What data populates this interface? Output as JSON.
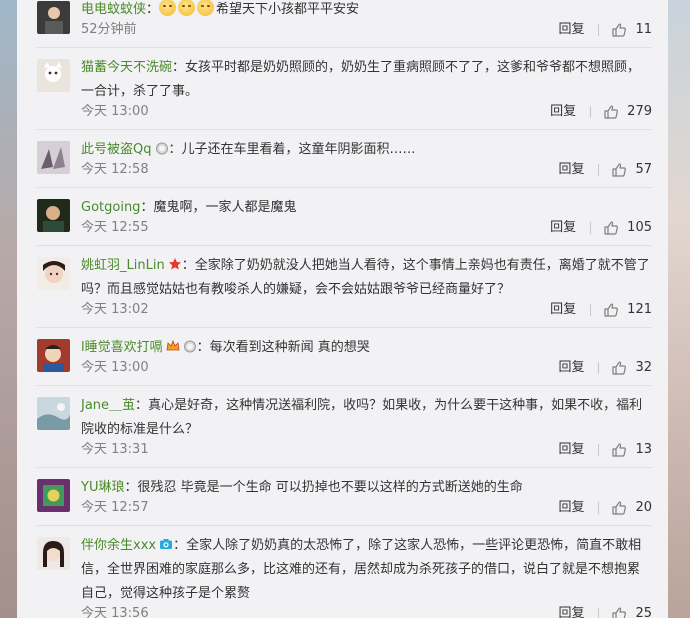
{
  "comments": [
    {
      "user": "电电蚊蚊侠",
      "text": "希望天下小孩都平平安安",
      "time": "52分钟前",
      "reply": "回复",
      "likes": "11",
      "badges": [],
      "emojis": 3,
      "avatar": "avatar-1"
    },
    {
      "user": "猫蓄今天不洗碗",
      "text": "女孩平时都是奶奶照顾的，奶奶生了重病照顾不了了，这爹和爷爷都不想照顾，一合计，杀了了事。",
      "time": "今天 13:00",
      "reply": "回复",
      "likes": "279",
      "badges": [],
      "avatar": "avatar-2"
    },
    {
      "user": "此号被盗Qq",
      "text": "儿子还在车里看着，这童年阴影面积……",
      "time": "今天 12:58",
      "reply": "回复",
      "likes": "57",
      "badges": [
        "medal"
      ],
      "avatar": "avatar-3"
    },
    {
      "user": "Gotgoing",
      "text": "魔鬼啊，一家人都是魔鬼",
      "time": "今天 12:55",
      "reply": "回复",
      "likes": "105",
      "badges": [],
      "avatar": "avatar-4"
    },
    {
      "user": "姚虹羽_LinLin",
      "text": "全家除了奶奶就没人把她当人看待，这个事情上亲妈也有责任，离婚了就不管了吗？而且感觉姑姑也有教唆杀人的嫌疑，会不会姑姑跟爷爷已经商量好了？",
      "time": "今天 13:02",
      "reply": "回复",
      "likes": "121",
      "badges": [
        "star"
      ],
      "avatar": "avatar-5"
    },
    {
      "user": "l睡觉喜欢打嗝",
      "text": "每次看到这种新闻 真的想哭",
      "time": "今天 13:00",
      "reply": "回复",
      "likes": "32",
      "badges": [
        "crown",
        "medal"
      ],
      "avatar": "avatar-6"
    },
    {
      "user": "Jane＿茧",
      "text": "真心是好奇，这种情况送福利院，收吗？如果收，为什么要干这种事，如果不收，福利院收的标准是什么？",
      "time": "今天 13:31",
      "reply": "回复",
      "likes": "13",
      "badges": [],
      "avatar": "avatar-7"
    },
    {
      "user": "YU琳琅",
      "text": "很残忍 毕竟是一个生命 可以扔掉也不要以这样的方式断送她的生命",
      "time": "今天 12:57",
      "reply": "回复",
      "likes": "20",
      "badges": [],
      "avatar": "avatar-8"
    },
    {
      "user": "伴你余生xxx",
      "text": "全家人除了奶奶真的太恐怖了，除了这家人恐怖，一些评论更恐怖，简直不敢相信，全世界困难的家庭那么多，比这难的还有，居然却成为杀死孩子的借口，说白了就是不想抱累自己，觉得这种孩子是个累赘",
      "time": "今天 13:56",
      "reply": "回复",
      "likes": "25",
      "badges": [
        "camera"
      ],
      "avatar": "avatar-9"
    }
  ],
  "colors": {
    "username": "#4a8a2a",
    "text": "#333333",
    "meta": "#808080",
    "panel": "#f2f2f5"
  }
}
